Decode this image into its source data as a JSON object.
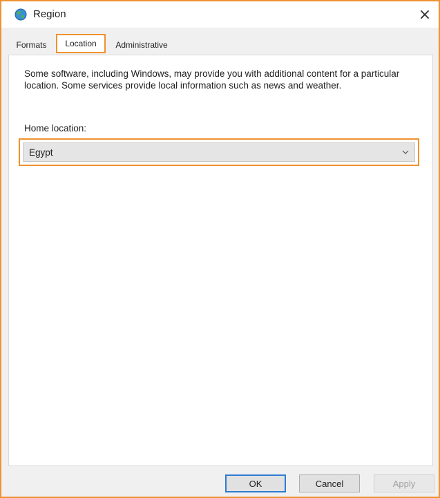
{
  "window": {
    "title": "Region",
    "close_glyph": "×",
    "icon": "globe-icon",
    "accent_color": "#f0922e"
  },
  "tabs": [
    {
      "label": "Formats",
      "active": false
    },
    {
      "label": "Location",
      "active": true
    },
    {
      "label": "Administrative",
      "active": false
    }
  ],
  "location": {
    "description": "Some software, including Windows, may provide you with additional content for a particular location. Some services provide local information such as news and weather.",
    "home_label": "Home location:",
    "home_value": "Egypt"
  },
  "buttons": {
    "ok": "OK",
    "cancel": "Cancel",
    "apply": "Apply"
  }
}
